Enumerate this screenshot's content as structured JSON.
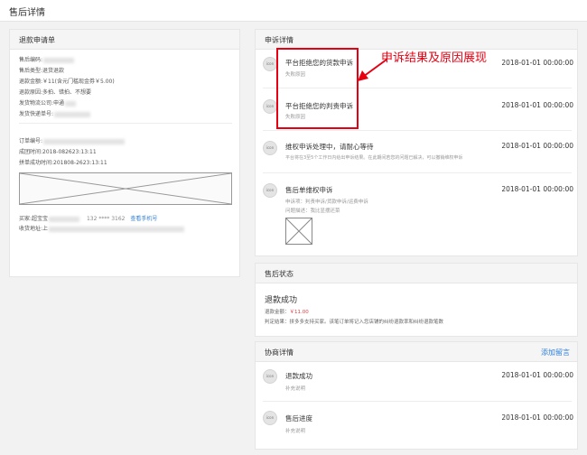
{
  "page": {
    "title": "售后详情"
  },
  "left": {
    "header": "退款申请单",
    "fields": [
      {
        "text": "售后编码:"
      },
      {
        "text": "售后类型:退货退款"
      },
      {
        "text": "退款金额:￥11(含元门槛现金券￥5.00)"
      },
      {
        "text": "退款原因:多拍、错拍、不想要"
      },
      {
        "text": "发货物流公司:申通"
      },
      {
        "text": "发货快递单号:"
      }
    ],
    "order_fields": [
      {
        "text": "订单编号:"
      },
      {
        "text": "成团时间:2018-082623:13:11"
      },
      {
        "text": "拼单成功时间:201808-2623:13:11"
      }
    ],
    "buyer_label": "买家:超宝宝",
    "buyer_phone": "132 **** 3162",
    "buyer_link": "查看手机号",
    "address_label": "收货地址:上"
  },
  "complaint": {
    "header": "申诉详情",
    "items": [
      {
        "avatar": "icon",
        "title": "平台拒绝您的货款申诉",
        "sub": "失败原因",
        "time": "2018-01-01 00:00:00"
      },
      {
        "avatar": "icon",
        "title": "平台拒绝您的判责申诉",
        "sub": "失败原因",
        "time": "2018-01-01 00:00:00"
      },
      {
        "avatar": "icon",
        "title": "维权申诉处理中，请耐心等待",
        "sub": "平台将在3至5个工作日内给出申诉结果。在此期间若您的问题已解决，可以撤销维权申诉",
        "time": "2018-01-01 00:00:00"
      },
      {
        "avatar": "icon",
        "title": "售后单维权申诉",
        "sub": "申诉项：判责申诉/货款申诉/运费申诉",
        "sub2": "问题描述：我比显摆还菜",
        "time": "2018-01-01 00:00:00"
      }
    ]
  },
  "status": {
    "header": "售后状态",
    "big": "退款成功",
    "amount_label": "退款金额：",
    "amount_value": "￥11.00",
    "result": "判定结果：拼多多支持买家。该笔订单将记入您店铺的纠纷退款率和纠纷退款笔数"
  },
  "nego": {
    "header": "协商详情",
    "add_link": "添加留言",
    "items": [
      {
        "avatar": "icon",
        "title": "退款成功",
        "sub": "补充说明",
        "time": "2018-01-01 00:00:00"
      },
      {
        "avatar": "icon",
        "title": "售后进度",
        "sub": "补充说明",
        "time": "2018-01-01 00:00:00"
      }
    ]
  },
  "annotation": {
    "text": "申诉结果及原因展现",
    "color": "#e60012"
  }
}
